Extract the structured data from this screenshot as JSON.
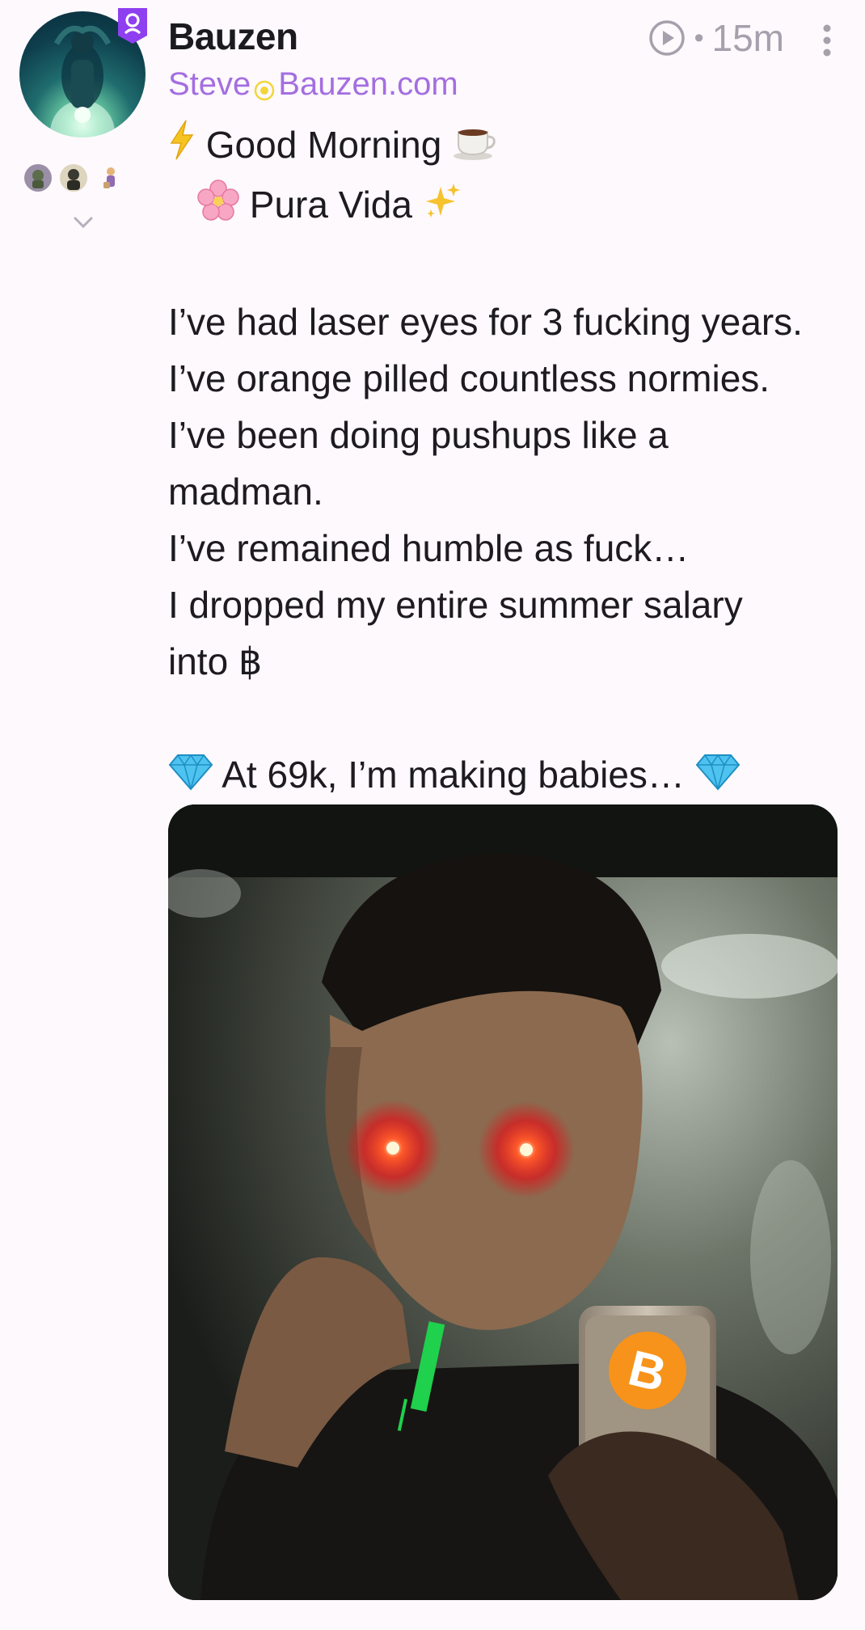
{
  "author": {
    "display_name": "Bauzen",
    "nip05_user": "Steve",
    "nip05_domain": "Bauzen.com",
    "avatar_icon": "avatar-photo",
    "badge_icon": "verified-badge-icon",
    "badge_color": "#8e3ff0"
  },
  "meta": {
    "timestamp": "15m",
    "separator": "•"
  },
  "content": {
    "line1": "Good Morning",
    "line2": "Pura Vida",
    "body": [
      "I’ve had laser eyes for 3 fucking years.",
      "I’ve orange pilled countless normies.",
      "I’ve been doing pushups like a",
      "madman.",
      "I’ve remained humble as fuck…",
      "I dropped my entire summer salary",
      "into ฿"
    ],
    "closing": "At 69k, I’m making babies…"
  },
  "colors": {
    "accent": "#a46ee0",
    "muted": "#a6a0ac",
    "bitcoin_orange": "#f7931a"
  }
}
